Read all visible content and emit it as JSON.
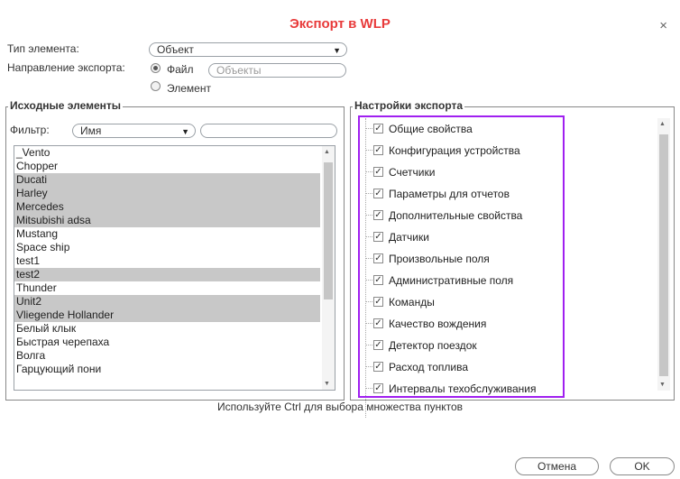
{
  "dialog": {
    "title": "Экспорт в WLP",
    "close_glyph": "×"
  },
  "element_type": {
    "label": "Тип элемента:",
    "value": "Объект",
    "arrow": "▼"
  },
  "export_direction": {
    "label": "Направление экспорта:",
    "file_label": "Файл",
    "file_name_placeholder": "Объекты",
    "element_label": "Элемент"
  },
  "source": {
    "legend": "Исходные элементы",
    "filter_label": "Фильтр:",
    "filter_field": "Имя",
    "filter_arrow": "▼",
    "items": [
      {
        "label": "_Vento",
        "selected": false
      },
      {
        "label": "Chopper",
        "selected": false
      },
      {
        "label": "Ducati",
        "selected": true
      },
      {
        "label": "Harley",
        "selected": true
      },
      {
        "label": "Mercedes",
        "selected": true
      },
      {
        "label": "Mitsubishi adsa",
        "selected": true
      },
      {
        "label": "Mustang",
        "selected": false
      },
      {
        "label": "Space ship",
        "selected": false
      },
      {
        "label": "test1",
        "selected": false
      },
      {
        "label": "test2",
        "selected": true
      },
      {
        "label": "Thunder",
        "selected": false
      },
      {
        "label": "Unit2",
        "selected": true
      },
      {
        "label": "Vliegende Hollander",
        "selected": true
      },
      {
        "label": "Белый клык",
        "selected": false
      },
      {
        "label": "Быстрая черепаха",
        "selected": false
      },
      {
        "label": "Волга",
        "selected": false
      },
      {
        "label": "Гарцующий пони",
        "selected": false
      }
    ]
  },
  "settings": {
    "legend": "Настройки экспорта",
    "items": [
      "Общие свойства",
      "Конфигурация устройства",
      "Счетчики",
      "Параметры для отчетов",
      "Дополнительные свойства",
      "Датчики",
      "Произвольные поля",
      "Административные поля",
      "Команды",
      "Качество вождения",
      "Детектор поездок",
      "Расход топлива",
      "Интервалы техобслуживания"
    ],
    "check_glyph": "✓"
  },
  "hint": "Используйте Ctrl для выбора множества пунктов",
  "buttons": {
    "cancel": "Отмена",
    "ok": "OK"
  },
  "colors": {
    "title": "#e83a3a",
    "highlight": "#a020f0",
    "selected_row": "#c8c8c8"
  }
}
